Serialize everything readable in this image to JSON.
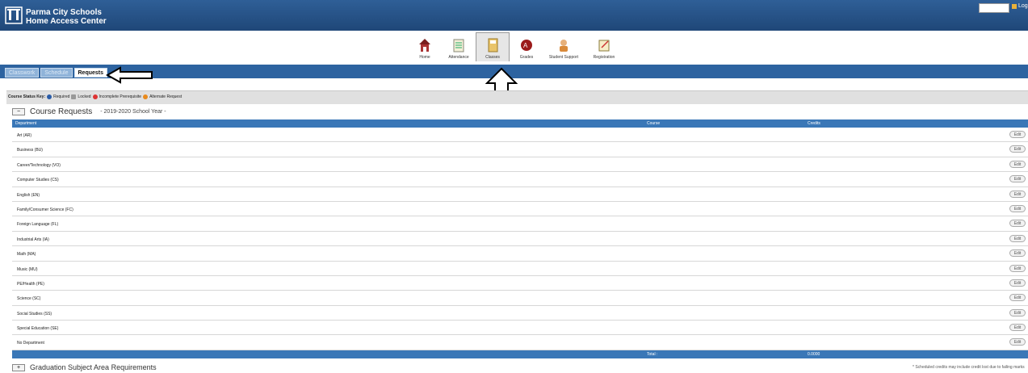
{
  "header": {
    "school_line1": "Parma City Schools",
    "school_line2": "Home Access Center",
    "logoff": "Log"
  },
  "nav": {
    "items": [
      {
        "label": "Home"
      },
      {
        "label": "Attendance"
      },
      {
        "label": "Classes"
      },
      {
        "label": "Grades"
      },
      {
        "label": "Student Support"
      },
      {
        "label": "Registration"
      }
    ]
  },
  "tabs": [
    {
      "label": "Classwork"
    },
    {
      "label": "Schedule"
    },
    {
      "label": "Requests"
    }
  ],
  "status_key": {
    "label": "Course Status Key:",
    "required": "Required",
    "locked": "Locked",
    "incomplete": "Incomplete Prerequisite",
    "alternate": "Alternate Request"
  },
  "course_requests": {
    "toggle": "−",
    "title": "Course Requests",
    "year": "- 2019-2020 School Year -",
    "col_department": "Department",
    "col_course": "Course",
    "col_credits": "Credits",
    "edit_label": "Edit",
    "rows": [
      "Art (AR)",
      "Business (BU)",
      "Career/Technology (VO)",
      "Computer Studies (CS)",
      "English (EN)",
      "Family/Consumer Science (FC)",
      "Foreign Language (FL)",
      "Industrial Arts (IA)",
      "Math (MA)",
      "Music (MU)",
      "PE/Health (PE)",
      "Science (SC)",
      "Social Studies (SS)",
      "Special Education (SE)",
      "No Department"
    ],
    "total_label": "Total :",
    "total_value": "0.0000"
  },
  "graduation": {
    "toggle": "+",
    "title": "Graduation Subject Area Requirements",
    "footnote": "* Scheduled credits may include credit lost due to failing marks"
  },
  "colors": {
    "header_blue": "#1f4778",
    "bar_blue": "#2d63a0",
    "table_blue": "#3a77b7"
  }
}
